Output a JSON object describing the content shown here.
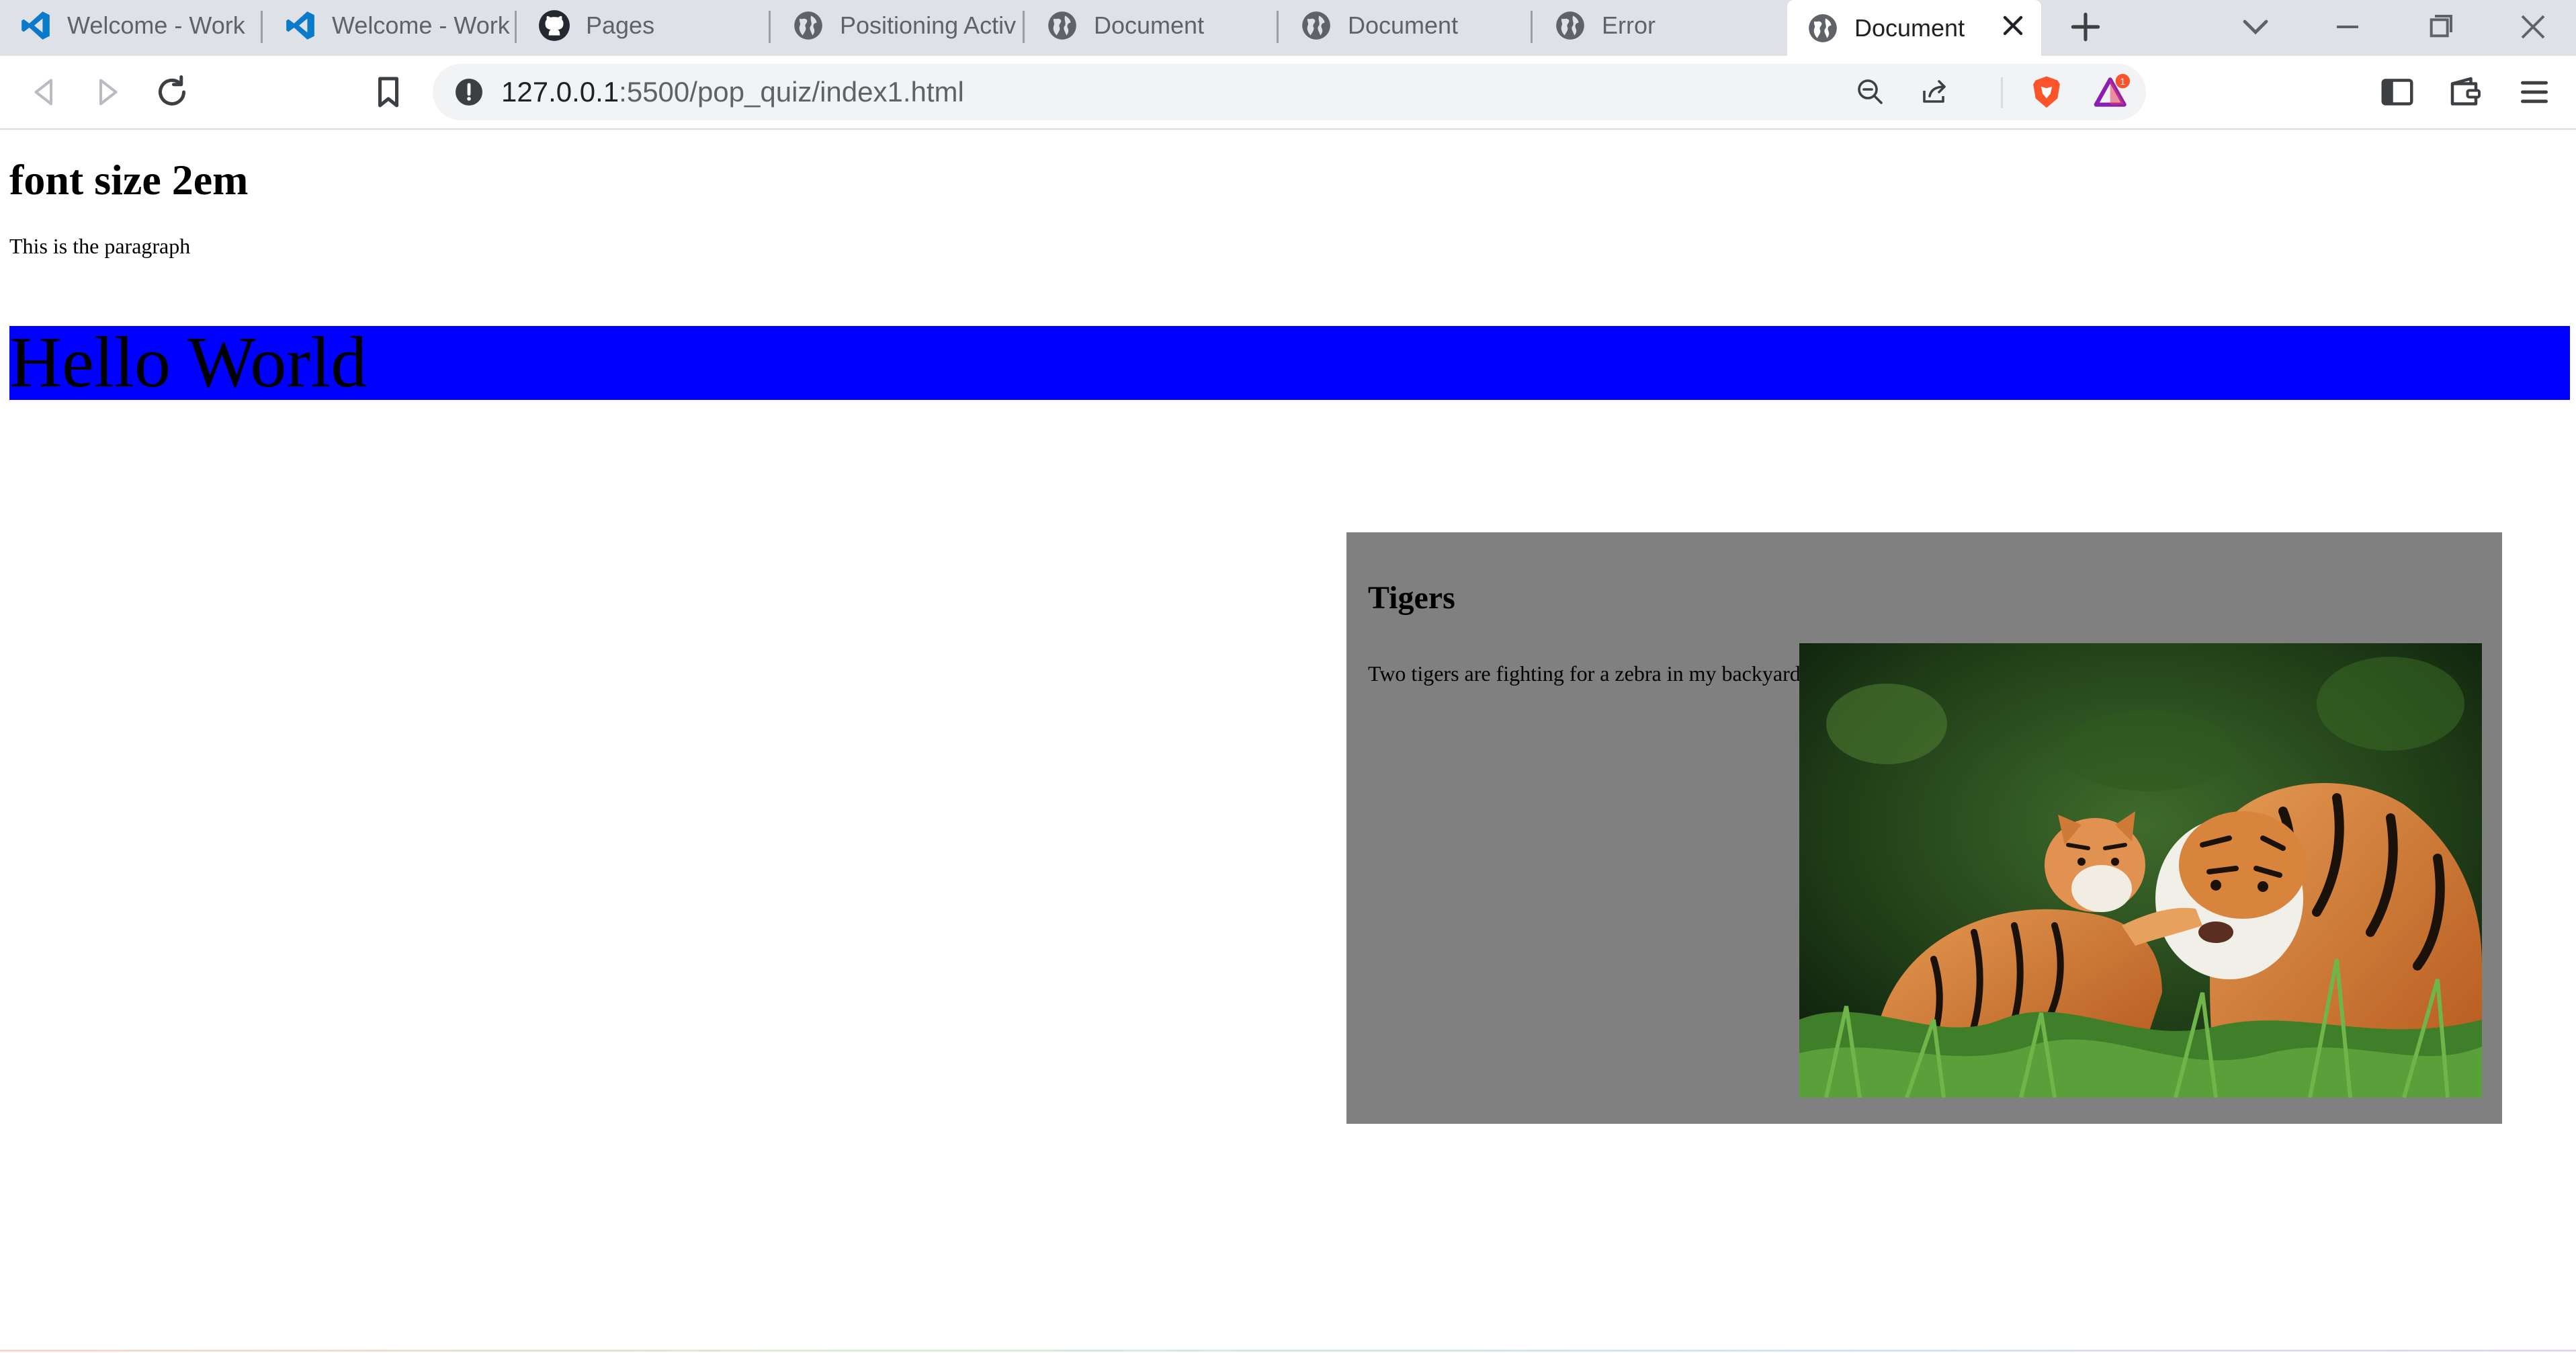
{
  "tabs": [
    {
      "label": "Welcome - Work",
      "icon": "vscode-icon"
    },
    {
      "label": "Welcome - Work",
      "icon": "vscode-icon"
    },
    {
      "label": "Pages",
      "icon": "github-icon"
    },
    {
      "label": "Positioning Activ",
      "icon": "globe-icon"
    },
    {
      "label": "Document",
      "icon": "globe-icon"
    },
    {
      "label": "Document",
      "icon": "globe-icon"
    },
    {
      "label": "Error",
      "icon": "globe-icon"
    },
    {
      "label": "Document",
      "icon": "globe-icon",
      "active": true
    }
  ],
  "toolbar": {
    "url_host": "127.0.0.1",
    "url_path": ":5500/pop_quiz/index1.html",
    "rewards_badge": "1"
  },
  "page": {
    "heading": "font size 2em",
    "paragraph": "This is the paragraph",
    "hello": "Hello World",
    "tigers_title": "Tigers",
    "tigers_text": "Two tigers are fighting for a zebra in my backyard"
  },
  "colors": {
    "hello_background": "#0000ff",
    "tigers_box_background": "#808080",
    "tab_strip": "#dee1e6",
    "brave_orange": "#fb542b"
  }
}
